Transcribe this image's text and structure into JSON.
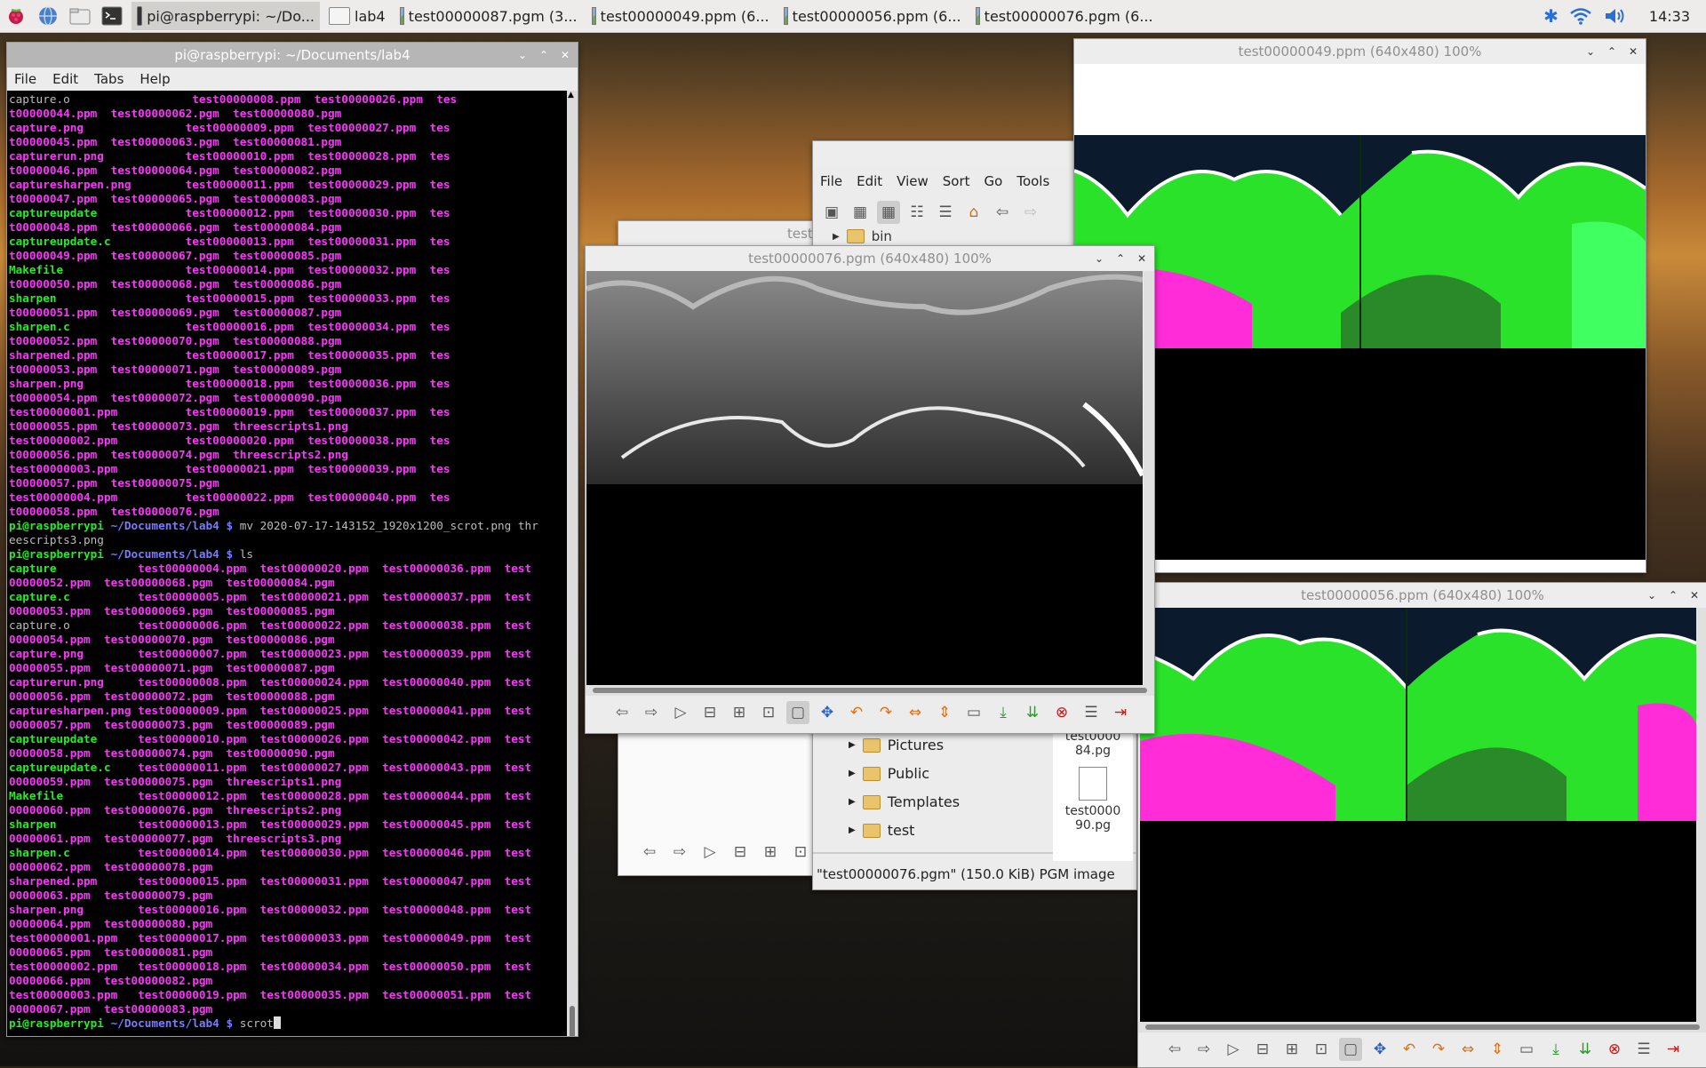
{
  "taskbar": {
    "tasks": [
      {
        "label": "pi@raspberrypi: ~/Do...",
        "icon": "terminal-icon",
        "active": true
      },
      {
        "label": "lab4",
        "icon": "folder-icon"
      },
      {
        "label": "test00000087.pgm (3...",
        "icon": "image-icon"
      },
      {
        "label": "test00000049.ppm (6...",
        "icon": "image-icon"
      },
      {
        "label": "test00000056.ppm (6...",
        "icon": "image-icon"
      },
      {
        "label": "test00000076.pgm (6...",
        "icon": "image-icon"
      }
    ],
    "clock": "14:33"
  },
  "terminal": {
    "title": "pi@raspberrypi: ~/Documents/lab4",
    "menu": [
      "File",
      "Edit",
      "Tabs",
      "Help"
    ],
    "lines": [
      [
        [
          "capture.o",
          "w"
        ],
        [
          "                  ",
          ""
        ],
        [
          "test00000008.ppm  test00000026.ppm  tes",
          "m"
        ]
      ],
      [
        [
          "t00000044.ppm  test00000062.pgm  test00000080.pgm",
          "m"
        ]
      ],
      [
        [
          "capture.png",
          "m"
        ],
        [
          "               ",
          ""
        ],
        [
          "test00000009.ppm  test00000027.ppm  tes",
          "m"
        ]
      ],
      [
        [
          "t00000045.ppm  test00000063.pgm  test00000081.pgm",
          "m"
        ]
      ],
      [
        [
          "capturerun.png",
          "m"
        ],
        [
          "            ",
          ""
        ],
        [
          "test00000010.ppm  test00000028.ppm  tes",
          "m"
        ]
      ],
      [
        [
          "t00000046.ppm  test00000064.pgm  test00000082.pgm",
          "m"
        ]
      ],
      [
        [
          "capturesharpen.png",
          "m"
        ],
        [
          "        ",
          ""
        ],
        [
          "test00000011.ppm  test00000029.ppm  tes",
          "m"
        ]
      ],
      [
        [
          "t00000047.ppm  test00000065.pgm  test00000083.pgm",
          "m"
        ]
      ],
      [
        [
          "captureupdate",
          "g"
        ],
        [
          "             ",
          ""
        ],
        [
          "test00000012.ppm  test00000030.ppm  tes",
          "m"
        ]
      ],
      [
        [
          "t00000048.ppm  test00000066.pgm  test00000084.pgm",
          "m"
        ]
      ],
      [
        [
          "captureupdate.c",
          "g"
        ],
        [
          "           ",
          ""
        ],
        [
          "test00000013.ppm  test00000031.ppm  tes",
          "m"
        ]
      ],
      [
        [
          "t00000049.ppm  test00000067.pgm  test00000085.pgm",
          "m"
        ]
      ],
      [
        [
          "Makefile",
          "g"
        ],
        [
          "                  ",
          ""
        ],
        [
          "test00000014.ppm  test00000032.ppm  tes",
          "m"
        ]
      ],
      [
        [
          "t00000050.ppm  test00000068.pgm  test00000086.pgm",
          "m"
        ]
      ],
      [
        [
          "sharpen",
          "g"
        ],
        [
          "                   ",
          ""
        ],
        [
          "test00000015.ppm  test00000033.ppm  tes",
          "m"
        ]
      ],
      [
        [
          "t00000051.ppm  test00000069.pgm  test00000087.pgm",
          "m"
        ]
      ],
      [
        [
          "sharpen.c",
          "g"
        ],
        [
          "                 ",
          ""
        ],
        [
          "test00000016.ppm  test00000034.ppm  tes",
          "m"
        ]
      ],
      [
        [
          "t00000052.ppm  test00000070.pgm  test00000088.pgm",
          "m"
        ]
      ],
      [
        [
          "sharpened.ppm",
          "m"
        ],
        [
          "             ",
          ""
        ],
        [
          "test00000017.ppm  test00000035.ppm  tes",
          "m"
        ]
      ],
      [
        [
          "t00000053.ppm  test00000071.pgm  test00000089.pgm",
          "m"
        ]
      ],
      [
        [
          "sharpen.png",
          "m"
        ],
        [
          "               ",
          ""
        ],
        [
          "test00000018.ppm  test00000036.ppm  tes",
          "m"
        ]
      ],
      [
        [
          "t00000054.ppm  test00000072.pgm  test00000090.pgm",
          "m"
        ]
      ],
      [
        [
          "test00000001.ppm",
          "m"
        ],
        [
          "          ",
          ""
        ],
        [
          "test00000019.ppm  test00000037.ppm  tes",
          "m"
        ]
      ],
      [
        [
          "t00000055.ppm  test00000073.pgm  threescripts1.png",
          "m"
        ]
      ],
      [
        [
          "test00000002.ppm",
          "m"
        ],
        [
          "          ",
          ""
        ],
        [
          "test00000020.ppm  test00000038.ppm  tes",
          "m"
        ]
      ],
      [
        [
          "t00000056.ppm  test00000074.pgm  threescripts2.png",
          "m"
        ]
      ],
      [
        [
          "test00000003.ppm",
          "m"
        ],
        [
          "          ",
          ""
        ],
        [
          "test00000021.ppm  test00000039.ppm  tes",
          "m"
        ]
      ],
      [
        [
          "t00000057.ppm  test00000075.pgm",
          "m"
        ]
      ],
      [
        [
          "test00000004.ppm",
          "m"
        ],
        [
          "          ",
          ""
        ],
        [
          "test00000022.ppm  test00000040.ppm  tes",
          "m"
        ]
      ],
      [
        [
          "t00000058.ppm  test00000076.pgm",
          "m"
        ]
      ],
      [
        [
          "pi@raspberrypi",
          "g"
        ],
        [
          ":",
          ""
        ],
        [
          "~/Documents/lab4 $",
          "b"
        ],
        [
          " mv 2020-07-17-143152_1920x1200_scrot.png thr",
          "w"
        ]
      ],
      [
        [
          "eescripts3.png",
          "w"
        ]
      ],
      [
        [
          "pi@raspberrypi",
          "g"
        ],
        [
          ":",
          ""
        ],
        [
          "~/Documents/lab4 $",
          "b"
        ],
        [
          " ls",
          "w"
        ]
      ],
      [
        [
          "capture",
          "g"
        ],
        [
          "            ",
          ""
        ],
        [
          "test00000004.ppm  test00000020.ppm  test00000036.ppm  test",
          "m"
        ]
      ],
      [
        [
          "00000052.ppm  test00000068.pgm  test00000084.pgm",
          "m"
        ]
      ],
      [
        [
          "capture.c",
          "g"
        ],
        [
          "          ",
          ""
        ],
        [
          "test00000005.ppm  test00000021.ppm  test00000037.ppm  test",
          "m"
        ]
      ],
      [
        [
          "00000053.ppm  test00000069.pgm  test00000085.pgm",
          "m"
        ]
      ],
      [
        [
          "capture.o",
          "w"
        ],
        [
          "          ",
          ""
        ],
        [
          "test00000006.ppm  test00000022.ppm  test00000038.ppm  test",
          "m"
        ]
      ],
      [
        [
          "00000054.ppm  test00000070.pgm  test00000086.pgm",
          "m"
        ]
      ],
      [
        [
          "capture.png",
          "m"
        ],
        [
          "        ",
          ""
        ],
        [
          "test00000007.ppm  test00000023.ppm  test00000039.ppm  test",
          "m"
        ]
      ],
      [
        [
          "00000055.ppm  test00000071.pgm  test00000087.pgm",
          "m"
        ]
      ],
      [
        [
          "capturerun.png",
          "m"
        ],
        [
          "     ",
          ""
        ],
        [
          "test00000008.ppm  test00000024.ppm  test00000040.ppm  test",
          "m"
        ]
      ],
      [
        [
          "00000056.ppm  test00000072.pgm  test00000088.pgm",
          "m"
        ]
      ],
      [
        [
          "capturesharpen.png",
          "m"
        ],
        [
          " ",
          ""
        ],
        [
          "test00000009.ppm  test00000025.ppm  test00000041.ppm  test",
          "m"
        ]
      ],
      [
        [
          "00000057.ppm  test00000073.pgm  test00000089.pgm",
          "m"
        ]
      ],
      [
        [
          "captureupdate",
          "g"
        ],
        [
          "      ",
          ""
        ],
        [
          "test00000010.ppm  test00000026.ppm  test00000042.ppm  test",
          "m"
        ]
      ],
      [
        [
          "00000058.ppm  test00000074.pgm  test00000090.pgm",
          "m"
        ]
      ],
      [
        [
          "captureupdate.c",
          "g"
        ],
        [
          "    ",
          ""
        ],
        [
          "test00000011.ppm  test00000027.ppm  test00000043.ppm  test",
          "m"
        ]
      ],
      [
        [
          "00000059.ppm  test00000075.pgm  threescripts1.png",
          "m"
        ]
      ],
      [
        [
          "Makefile",
          "g"
        ],
        [
          "           ",
          ""
        ],
        [
          "test00000012.ppm  test00000028.ppm  test00000044.ppm  test",
          "m"
        ]
      ],
      [
        [
          "00000060.ppm  test00000076.pgm  threescripts2.png",
          "m"
        ]
      ],
      [
        [
          "sharpen",
          "g"
        ],
        [
          "            ",
          ""
        ],
        [
          "test00000013.ppm  test00000029.ppm  test00000045.ppm  test",
          "m"
        ]
      ],
      [
        [
          "00000061.ppm  test00000077.pgm  threescripts3.png",
          "m"
        ]
      ],
      [
        [
          "sharpen.c",
          "g"
        ],
        [
          "          ",
          ""
        ],
        [
          "test00000014.ppm  test00000030.ppm  test00000046.ppm  test",
          "m"
        ]
      ],
      [
        [
          "00000062.ppm  test00000078.pgm",
          "m"
        ]
      ],
      [
        [
          "sharpened.ppm",
          "m"
        ],
        [
          "      ",
          ""
        ],
        [
          "test00000015.ppm  test00000031.ppm  test00000047.ppm  test",
          "m"
        ]
      ],
      [
        [
          "00000063.ppm  test00000079.pgm",
          "m"
        ]
      ],
      [
        [
          "sharpen.png",
          "m"
        ],
        [
          "        ",
          ""
        ],
        [
          "test00000016.ppm  test00000032.ppm  test00000048.ppm  test",
          "m"
        ]
      ],
      [
        [
          "00000064.ppm  test00000080.pgm",
          "m"
        ]
      ],
      [
        [
          "test00000001.ppm",
          "m"
        ],
        [
          "   ",
          ""
        ],
        [
          "test00000017.ppm  test00000033.ppm  test00000049.ppm  test",
          "m"
        ]
      ],
      [
        [
          "00000065.ppm  test00000081.pgm",
          "m"
        ]
      ],
      [
        [
          "test00000002.ppm",
          "m"
        ],
        [
          "   ",
          ""
        ],
        [
          "test00000018.ppm  test00000034.ppm  test00000050.ppm  test",
          "m"
        ]
      ],
      [
        [
          "00000066.ppm  test00000082.pgm",
          "m"
        ]
      ],
      [
        [
          "test00000003.ppm",
          "m"
        ],
        [
          "   ",
          ""
        ],
        [
          "test00000019.ppm  test00000035.ppm  test00000051.ppm  test",
          "m"
        ]
      ],
      [
        [
          "00000067.ppm  test00000083.pgm",
          "m"
        ]
      ],
      [
        [
          "pi@raspberrypi",
          "g"
        ],
        [
          ":",
          ""
        ],
        [
          "~/Documents/lab4 $",
          "b"
        ],
        [
          " scrot",
          "w"
        ]
      ]
    ]
  },
  "viewer49": {
    "title": "test00000049.ppm (640x480) 100%"
  },
  "viewer56": {
    "title": "test00000056.ppm (640x480) 100%"
  },
  "viewer76": {
    "title": "test00000076.pgm (640x480) 100%"
  },
  "filemanager": {
    "menu": [
      "File",
      "Edit",
      "View",
      "Sort",
      "Go",
      "Tools"
    ],
    "path_fragment": "bin",
    "tree": [
      "Pictures",
      "Public",
      "Templates",
      "test"
    ],
    "files": [
      {
        "name": "test0000\n84.pg"
      },
      {
        "name": "test0000\n90.pg"
      }
    ],
    "status": "\"test00000076.pgm\" (150.0 KiB) PGM image"
  },
  "bg_window": {
    "title_fragment": "test"
  }
}
